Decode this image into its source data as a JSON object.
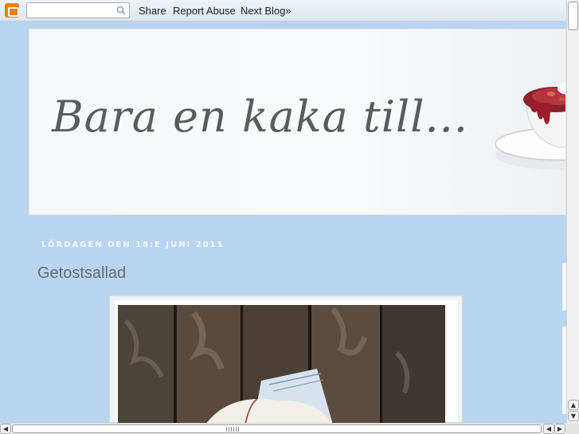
{
  "navbar": {
    "search_placeholder": "",
    "links": [
      "Share",
      "Report Abuse",
      "Next Blog»"
    ]
  },
  "header": {
    "blog_title": "Bara en kaka till..."
  },
  "post": {
    "date": "LÖRDAGEN DEN 18:E JUNI 2011",
    "title": "Getostsallad"
  },
  "colors": {
    "page_background": "#b8d4ee",
    "date_text": "#f3f7fb",
    "title_text": "#626b74",
    "blogger_orange": "#f57d00"
  },
  "icons": {
    "blogger": "blogger-logo-icon",
    "search": "magnifier-icon"
  }
}
